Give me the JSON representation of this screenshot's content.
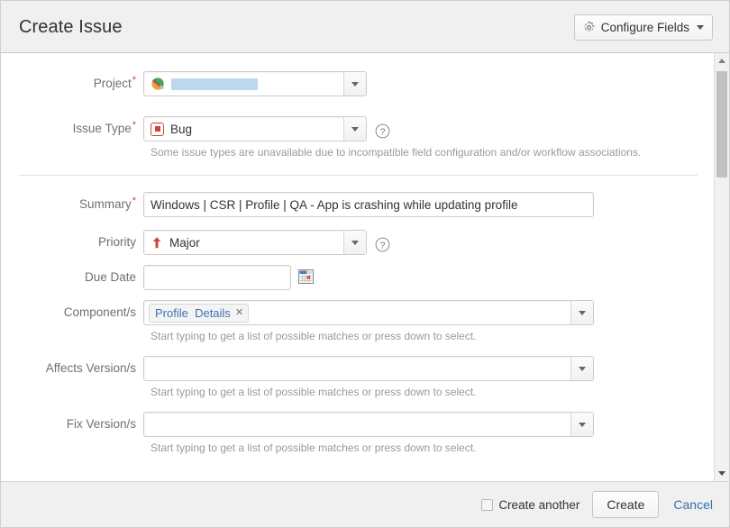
{
  "header": {
    "title": "Create Issue",
    "configure_fields_label": "Configure Fields",
    "gear_icon": "gear-icon",
    "caret_icon": "chevron-down-icon"
  },
  "form": {
    "project": {
      "label": "Project",
      "required": true,
      "value": "",
      "value_redacted": true,
      "icon": "globe-project-avatar-icon",
      "dropdown_icon": "chevron-down-icon"
    },
    "issue_type": {
      "label": "Issue Type",
      "required": true,
      "value": "Bug",
      "icon": "bug-issue-type-icon",
      "dropdown_icon": "chevron-down-icon",
      "help_icon": "question-mark-icon",
      "description": "Some issue types are unavailable due to incompatible field configuration and/or workflow associations."
    },
    "summary": {
      "label": "Summary",
      "required": true,
      "value": "Windows | CSR | Profile | QA - App is crashing while updating profile",
      "placeholder": ""
    },
    "priority": {
      "label": "Priority",
      "required": false,
      "value": "Major",
      "icon": "priority-major-up-arrow-icon",
      "dropdown_icon": "chevron-down-icon",
      "help_icon": "question-mark-icon"
    },
    "due_date": {
      "label": "Due Date",
      "required": false,
      "value": "",
      "placeholder": "",
      "calendar_icon": "calendar-icon"
    },
    "components": {
      "label": "Component/s",
      "required": false,
      "chips": [
        {
          "label": "Profile  Details",
          "remove_icon": "close-x-icon"
        }
      ],
      "dropdown_icon": "chevron-down-icon",
      "help_text": "Start typing to get a list of possible matches or press down to select."
    },
    "affects_versions": {
      "label": "Affects Version/s",
      "required": false,
      "value": "",
      "dropdown_icon": "chevron-down-icon",
      "help_text": "Start typing to get a list of possible matches or press down to select."
    },
    "fix_versions": {
      "label": "Fix Version/s",
      "required": false,
      "value": "",
      "dropdown_icon": "chevron-down-icon",
      "help_text": "Start typing to get a list of possible matches or press down to select."
    }
  },
  "scrollbar": {
    "up_icon": "scroll-up-arrow-icon",
    "down_icon": "scroll-down-arrow-icon"
  },
  "footer": {
    "create_another_label": "Create another",
    "create_another_checked": false,
    "create_label": "Create",
    "cancel_label": "Cancel"
  },
  "colors": {
    "required_asterisk": "#d04437",
    "link_blue": "#3572b0",
    "chip_text": "#3b73af",
    "header_bg": "#f0f0f0",
    "redaction": "#bdd7f0",
    "priority_major": "#d04437"
  }
}
